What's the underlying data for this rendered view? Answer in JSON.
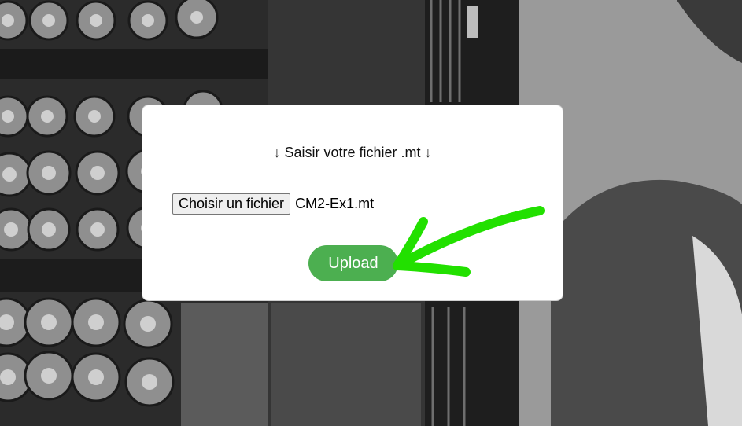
{
  "upload_form": {
    "prompt": "↓ Saisir votre fichier .mt ↓",
    "file_button_label": "Choisir un fichier",
    "selected_file": "CM2-Ex1.mt",
    "upload_button_label": "Upload"
  },
  "annotation": {
    "arrow_color": "#22e000",
    "icon": "hand-drawn-arrow-icon"
  },
  "colors": {
    "upload_button": "#4caf50",
    "card_background": "#ffffff"
  },
  "background": {
    "icon": "photo-background"
  }
}
